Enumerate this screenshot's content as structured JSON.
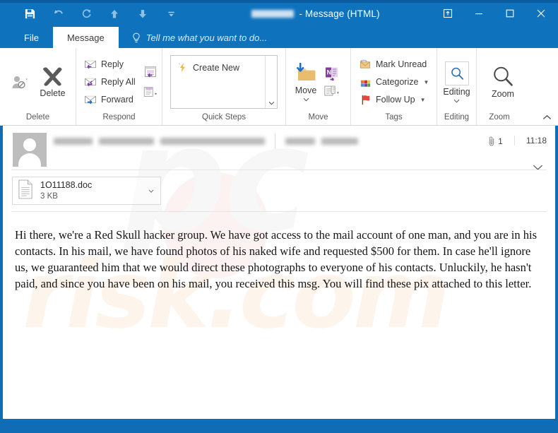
{
  "window": {
    "title_suffix": "- Message (HTML)",
    "title_redacted": true,
    "quick_access": [
      {
        "name": "save",
        "label": "Save",
        "icon": "floppy-disk-icon"
      },
      {
        "name": "undo",
        "label": "Undo",
        "icon": "undo-arrow-icon"
      },
      {
        "name": "redo",
        "label": "Redo",
        "icon": "redo-arrow-icon"
      },
      {
        "name": "previous-item",
        "label": "Previous Item",
        "icon": "arrow-up-icon"
      },
      {
        "name": "next-item",
        "label": "Next Item",
        "icon": "arrow-down-icon"
      },
      {
        "name": "customize-qat",
        "label": "Customize Quick Access Toolbar",
        "icon": "chevron-down-icon"
      }
    ],
    "controls": [
      {
        "name": "restore-down",
        "label": "Restore Down",
        "icon": "popout-icon"
      },
      {
        "name": "minimize",
        "label": "Minimize",
        "icon": "minimize-icon"
      },
      {
        "name": "maximize",
        "label": "Maximize",
        "icon": "maximize-icon"
      },
      {
        "name": "close",
        "label": "Close",
        "icon": "close-icon"
      }
    ]
  },
  "ribbon": {
    "tabs": [
      {
        "label": "File",
        "active": false
      },
      {
        "label": "Message",
        "active": true
      }
    ],
    "tellme_placeholder": "Tell me what you want to do...",
    "collapse_label": "Collapse the Ribbon",
    "groups": [
      {
        "name": "delete",
        "label": "Delete",
        "buttons": [
          {
            "label": "Ignore",
            "icon": "ignore-person-icon",
            "disabled": true
          },
          {
            "label": "Delete",
            "icon": "delete-x-icon",
            "disabled": false
          }
        ]
      },
      {
        "name": "respond",
        "label": "Respond",
        "buttons": [
          {
            "label": "Reply",
            "icon": "reply-envelope-icon"
          },
          {
            "label": "Reply All",
            "icon": "reply-all-envelope-icon"
          },
          {
            "label": "Forward",
            "icon": "forward-envelope-icon"
          },
          {
            "label": "Meeting",
            "icon": "meeting-calendar-icon"
          },
          {
            "label": "More",
            "icon": "more-respond-icon"
          }
        ]
      },
      {
        "name": "quick-steps",
        "label": "Quick Steps",
        "items": [
          {
            "label": "Create New",
            "icon": "lightning-bolt-icon"
          }
        ]
      },
      {
        "name": "move",
        "label": "Move",
        "buttons": [
          {
            "label": "Move",
            "icon": "move-folder-icon"
          },
          {
            "label": "OneNote",
            "icon": "onenote-icon"
          },
          {
            "label": "Rules",
            "icon": "rules-actions-icon"
          }
        ]
      },
      {
        "name": "tags",
        "label": "Tags",
        "buttons": [
          {
            "label": "Mark Unread",
            "icon": "mark-unread-envelope-icon"
          },
          {
            "label": "Categorize",
            "icon": "categorize-squares-icon"
          },
          {
            "label": "Follow Up",
            "icon": "follow-up-flag-icon"
          }
        ]
      },
      {
        "name": "editing",
        "label": "Editing",
        "buttons": [
          {
            "label": "Editing",
            "icon": "editing-magnifier-icon"
          }
        ]
      },
      {
        "name": "zoom",
        "label": "Zoom",
        "buttons": [
          {
            "label": "Zoom",
            "icon": "zoom-magnifier-icon"
          }
        ]
      }
    ]
  },
  "message": {
    "sender_redacted": true,
    "recipient_redacted": true,
    "attachment_count": "1",
    "timestamp": "11:18",
    "attachment": {
      "filename": "1O11188.doc",
      "size": "3 KB",
      "icon": "document-file-icon"
    },
    "body": "Hi there, we're a Red Skull hacker group. We have got access to the mail account of one man, and you are in his contacts. In his mail, we have found photos of his naked wife and requested $500 for them. In case he'll ignore us, we guaranteed him that we would direct these photographs to everyone of his contacts. Unluckily, he hasn't paid, and since you have been on his mail, you received this msg. You will find these pix attached to this letter."
  },
  "watermark": {
    "top_text": "pc",
    "bottom_text": "risk.com"
  },
  "colors": {
    "titlebar_blue": "#0f72bd",
    "window_border": "#0f6cb5",
    "accent_purple": "#7d3f98",
    "flag_red": "#e8443a",
    "folder_gold": "#e8bd6e",
    "watermark_cream": "#fdf4ec"
  }
}
